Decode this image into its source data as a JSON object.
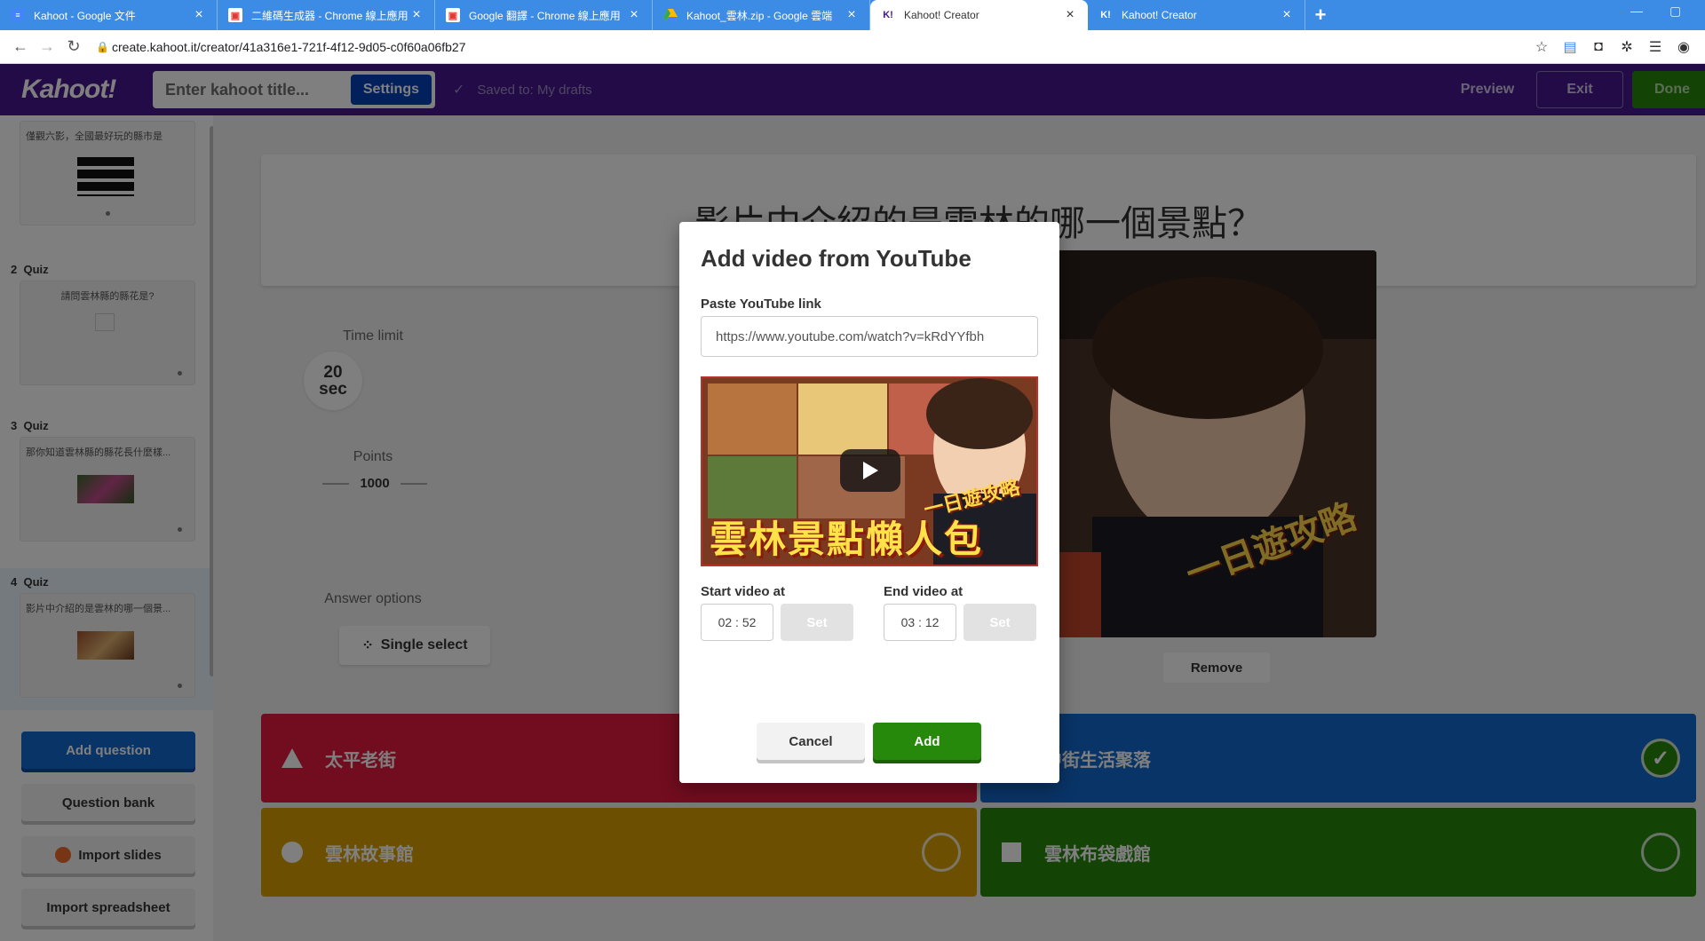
{
  "browser": {
    "tabs": [
      {
        "title": "Kahoot - Google 文件",
        "icon": "docs-icon"
      },
      {
        "title": "二維碼生成器 - Chrome 線上應用",
        "icon": "qr-app-icon"
      },
      {
        "title": "Google 翻譯 - Chrome 線上應用",
        "icon": "translate-app-icon"
      },
      {
        "title": "Kahoot_雲林.zip - Google 雲端",
        "icon": "drive-icon"
      },
      {
        "title": "Kahoot! Creator",
        "icon": "kahoot-icon"
      },
      {
        "title": "Kahoot! Creator",
        "icon": "kahoot-icon"
      }
    ],
    "url": "create.kahoot.it/creator/41a316e1-721f-4f12-9d05-c0f60a06fb27"
  },
  "header": {
    "logo": "Kahoot!",
    "title_placeholder": "Enter kahoot title...",
    "settings_label": "Settings",
    "saved_text": "Saved to: My drafts",
    "preview_label": "Preview",
    "exit_label": "Exit",
    "done_label": "Done"
  },
  "sidebar": {
    "slides": [
      {
        "number": "",
        "type": "",
        "question": "僅觀六影，全國最好玩的縣市是"
      },
      {
        "number": "2",
        "type": "Quiz",
        "question": "請問雲林縣的縣花是?"
      },
      {
        "number": "3",
        "type": "Quiz",
        "question": "那你知道雲林縣的縣花長什麼樣..."
      },
      {
        "number": "4",
        "type": "Quiz",
        "question": "影片中介紹的是雲林的哪一個景..."
      }
    ],
    "add_question": "Add question",
    "question_bank": "Question bank",
    "import_slides": "Import slides",
    "import_spreadsheet": "Import spreadsheet"
  },
  "editor": {
    "question": "影片中介紹的是雲林的哪一個景點？",
    "time_limit_label": "Time limit",
    "time_value": "20",
    "time_unit": "sec",
    "points_label": "Points",
    "points_value": "1000",
    "answer_options_label": "Answer options",
    "single_select": "Single select",
    "remove_label": "Remove",
    "answers": [
      {
        "text": "太平老街",
        "color": "#e21b3c",
        "shape": "triangle",
        "correct": false
      },
      {
        "text": "中街生活聚落",
        "color": "#1368ce",
        "shape": "diamond",
        "correct": true
      },
      {
        "text": "雲林故事館",
        "color": "#d89e00",
        "shape": "circle",
        "correct": false
      },
      {
        "text": "雲林布袋戲館",
        "color": "#26890c",
        "shape": "square",
        "correct": false
      }
    ],
    "video_overlay_text": "一日遊攻略"
  },
  "modal": {
    "title": "Add video from YouTube",
    "link_label": "Paste YouTube link",
    "link_value": "https://www.youtube.com/watch?v=kRdYYfbh",
    "thumbnail_caption": "雲林景點懶人包",
    "thumbnail_badge": "一日遊攻略",
    "start_label": "Start video at",
    "start_value": "02 : 52",
    "end_label": "End video at",
    "end_value": "03 : 12",
    "set_label": "Set",
    "cancel_label": "Cancel",
    "add_label": "Add"
  },
  "colors": {
    "kahoot_purple": "#46178f",
    "chrome_blue": "#3c8ce5",
    "add_green": "#26890c",
    "red": "#e21b3c",
    "blue": "#1368ce",
    "yellow": "#d89e00",
    "green": "#26890c"
  }
}
